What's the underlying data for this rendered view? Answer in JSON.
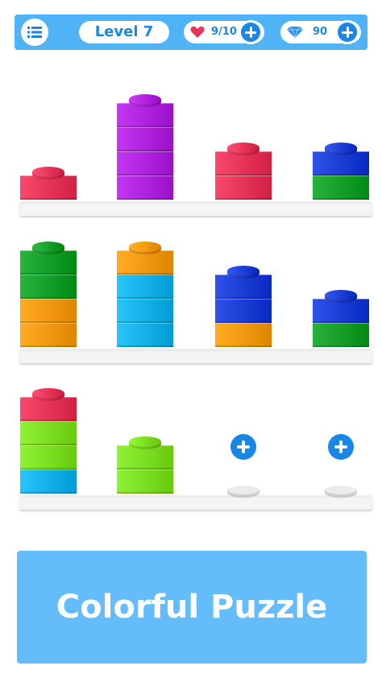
{
  "header": {
    "level_label": "Level 7",
    "lives": "9/10",
    "gems": "90"
  },
  "colors": {
    "red": "#e8365b",
    "purple": "#b225e0",
    "blue": "#1e3fd6",
    "green": "#17a12a",
    "orange": "#f59a13",
    "cyan": "#17b2ea",
    "lime": "#7ee022",
    "accent": "#1a86e6",
    "topbar": "#4fb3f6",
    "banner": "#64bdfa"
  },
  "board": {
    "rows": [
      {
        "pegs": [
          {
            "blocks": [
              "red"
            ],
            "empty": false
          },
          {
            "blocks": [
              "purple",
              "purple",
              "purple",
              "purple"
            ],
            "empty": false
          },
          {
            "blocks": [
              "red",
              "red"
            ],
            "empty": false
          },
          {
            "blocks": [
              "green",
              "blue"
            ],
            "empty": false
          }
        ]
      },
      {
        "pegs": [
          {
            "blocks": [
              "orange",
              "orange",
              "green",
              "green"
            ],
            "empty": false
          },
          {
            "blocks": [
              "cyan",
              "cyan",
              "cyan",
              "orange"
            ],
            "empty": false
          },
          {
            "blocks": [
              "orange",
              "blue",
              "blue"
            ],
            "empty": false
          },
          {
            "blocks": [
              "green",
              "blue"
            ],
            "empty": false
          }
        ]
      },
      {
        "pegs": [
          {
            "blocks": [
              "cyan",
              "lime",
              "lime",
              "red"
            ],
            "empty": false
          },
          {
            "blocks": [
              "lime",
              "lime"
            ],
            "empty": false
          },
          {
            "blocks": [],
            "empty": true,
            "add_button": true
          },
          {
            "blocks": [],
            "empty": true,
            "add_button": true
          }
        ]
      }
    ]
  },
  "banner": {
    "title": "Colorful Puzzle"
  }
}
